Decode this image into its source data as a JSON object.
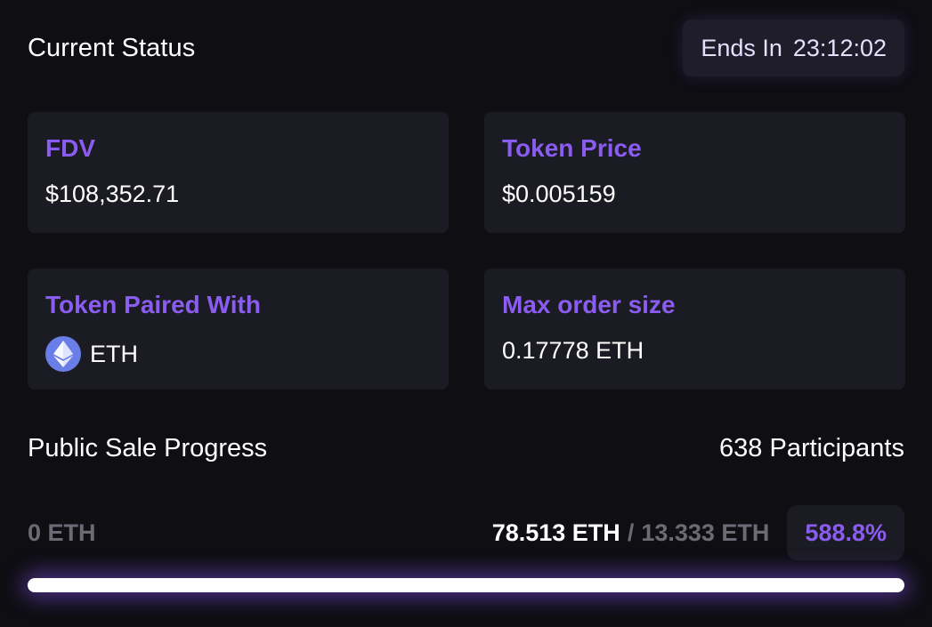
{
  "status": {
    "title": "Current Status",
    "timer_label": "Ends In",
    "timer_value": "23:12:02"
  },
  "cards": [
    {
      "label": "FDV",
      "value": "$108,352.71"
    },
    {
      "label": "Token Price",
      "value": "$0.005159"
    },
    {
      "label": "Token Paired With",
      "value": "ETH",
      "icon": "eth-icon"
    },
    {
      "label": "Max order size",
      "value": "0.17778 ETH"
    }
  ],
  "sale": {
    "title": "Public Sale Progress",
    "participants": "638 Participants",
    "min_amount": "0 ETH",
    "raised": "78.513 ETH",
    "separator": "/",
    "target": "13.333 ETH",
    "percent": "588.8%",
    "progress_fraction": 1.0
  },
  "colors": {
    "accent": "#8a5cf0",
    "background": "#0e0e13",
    "card": "#1b1b23",
    "eth_icon": "#6a7ee8"
  }
}
